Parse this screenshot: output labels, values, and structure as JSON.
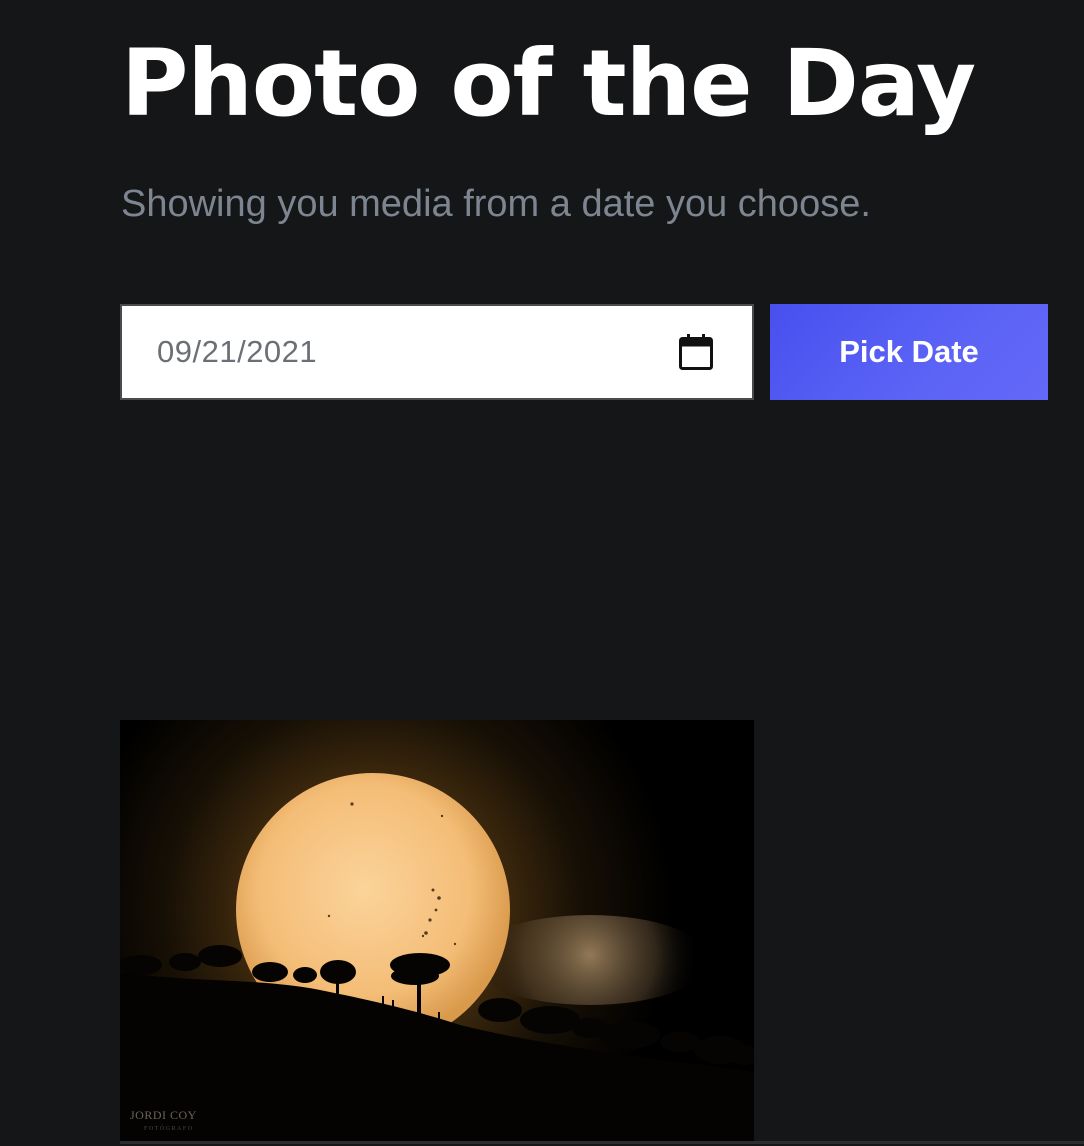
{
  "header": {
    "title": "Photo of the Day",
    "subtitle": "Showing you media from a date you choose."
  },
  "date_picker": {
    "value": "09/21/2021",
    "icon": "calendar-icon",
    "button_label": "Pick Date"
  },
  "media": {
    "type": "image",
    "watermark": "JORDI COY",
    "watermark_sub": "FOTÓGRAFO"
  },
  "colors": {
    "background": "#151618",
    "title": "#ffffff",
    "subtitle": "#7d8591",
    "button": "#5b63f6",
    "input_background": "#ffffff",
    "input_text": "#6b6f76"
  }
}
